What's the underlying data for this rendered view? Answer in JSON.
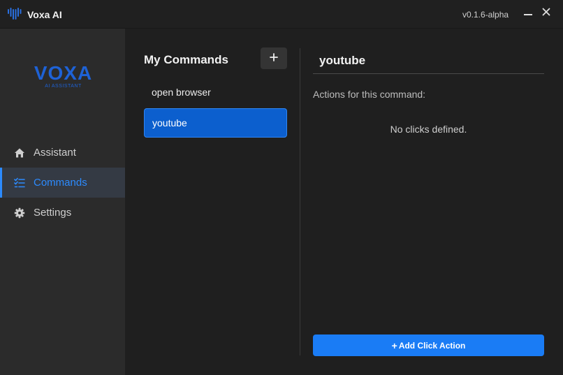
{
  "window": {
    "app_title": "Voxa AI",
    "version": "v0.1.6-alpha",
    "app_icon": "heart-waveform-icon",
    "minimize_icon": "minimize-icon",
    "close_icon": "close-icon"
  },
  "sidebar": {
    "logo_text": "VOXA",
    "logo_subtitle": "AI ASSISTANT",
    "items": [
      {
        "label": "Assistant",
        "icon": "home-icon",
        "active": false
      },
      {
        "label": "Commands",
        "icon": "checklist-icon",
        "active": true
      },
      {
        "label": "Settings",
        "icon": "gear-icon",
        "active": false
      }
    ]
  },
  "commands": {
    "title": "My Commands",
    "add_icon": "plus-icon",
    "items": [
      {
        "label": "open browser",
        "selected": false
      },
      {
        "label": "youtube",
        "selected": true
      }
    ]
  },
  "detail": {
    "title": "youtube",
    "actions_label": "Actions for this command:",
    "empty_message": "No clicks defined.",
    "add_button_label": "Add Click Action",
    "add_button_icon": "plus-icon"
  },
  "colors": {
    "accent": "#1a7cf5",
    "selected_item": "#0c5fce",
    "logo": "#1e62d6",
    "sidebar_bg": "#2b2b2b",
    "main_bg": "#1f1f1f"
  }
}
